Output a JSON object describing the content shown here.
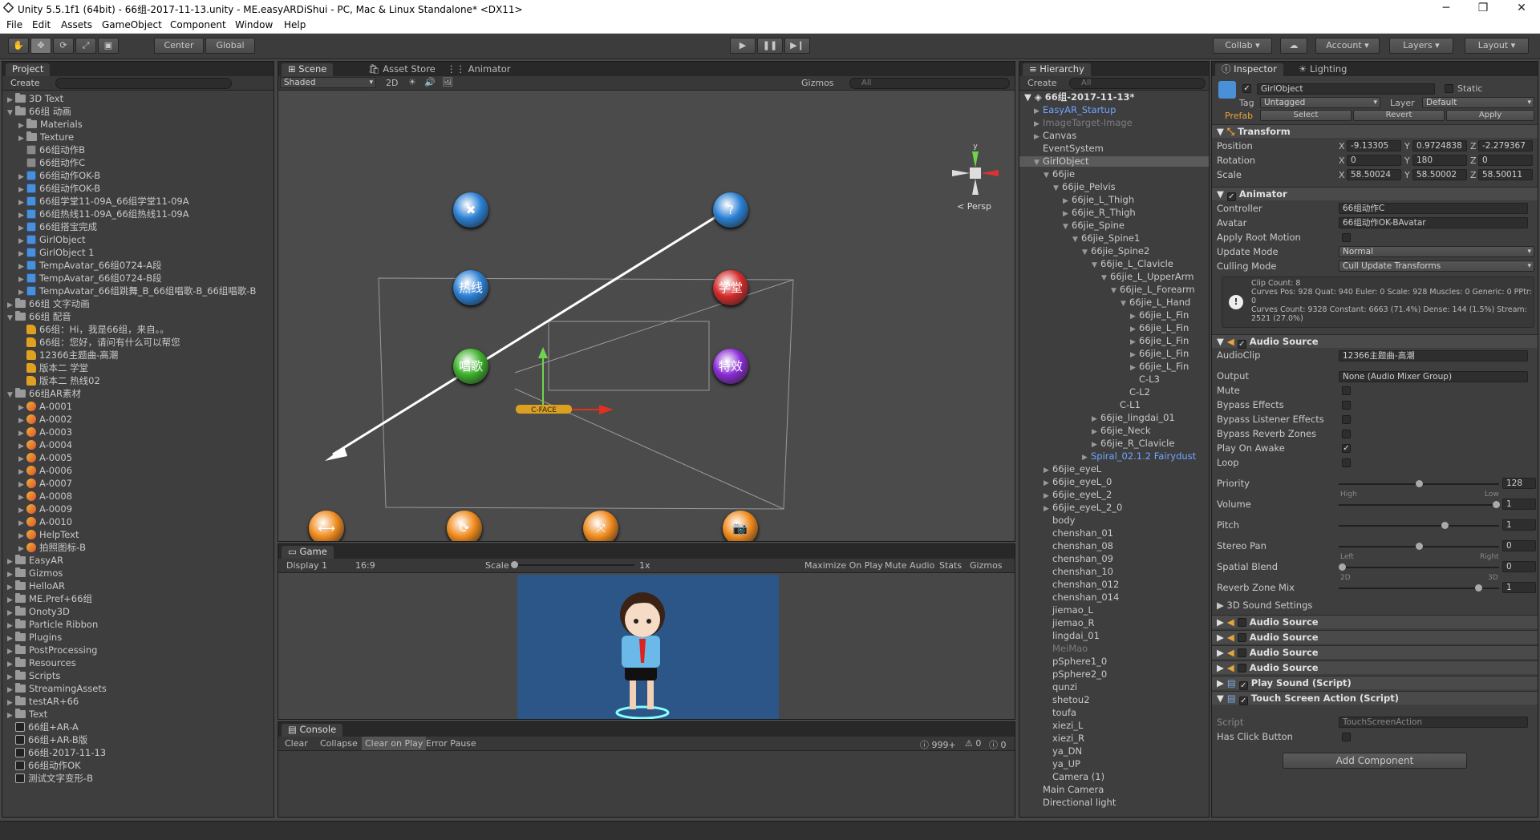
{
  "title": "Unity 5.5.1f1 (64bit) - 66组-2017-11-13.unity - ME.easyARDiShui - PC, Mac & Linux Standalone* <DX11>",
  "menu": [
    "File",
    "Edit",
    "Assets",
    "GameObject",
    "Component",
    "Window",
    "Help"
  ],
  "toolbar": {
    "center": "Center",
    "global": "Global",
    "collab": "Collab",
    "account": "Account",
    "layers": "Layers",
    "layout": "Layout"
  },
  "project": {
    "tab": "Project",
    "create": "Create",
    "items": [
      {
        "t": "3D Text",
        "d": 0,
        "k": "folder",
        "a": "▶"
      },
      {
        "t": "66组 动画",
        "d": 0,
        "k": "folder",
        "a": "▼"
      },
      {
        "t": "Materials",
        "d": 1,
        "k": "folder",
        "a": "▶"
      },
      {
        "t": "Texture",
        "d": 1,
        "k": "folder",
        "a": "▶"
      },
      {
        "t": "66组动作B",
        "d": 1,
        "k": "anim",
        "a": ""
      },
      {
        "t": "66组动作C",
        "d": 1,
        "k": "anim",
        "a": ""
      },
      {
        "t": "66组动作OK-B",
        "d": 1,
        "k": "prefab",
        "a": "▶"
      },
      {
        "t": "66组动作OK-B",
        "d": 1,
        "k": "prefab",
        "a": "▶"
      },
      {
        "t": "66组学堂11-09A_66组学堂11-09A",
        "d": 1,
        "k": "prefab",
        "a": "▶"
      },
      {
        "t": "66组热线11-09A_66组热线11-09A",
        "d": 1,
        "k": "prefab",
        "a": "▶"
      },
      {
        "t": "66组搭宝完成",
        "d": 1,
        "k": "prefab",
        "a": "▶"
      },
      {
        "t": "GirlObject",
        "d": 1,
        "k": "prefab",
        "a": "▶"
      },
      {
        "t": "GirlObject 1",
        "d": 1,
        "k": "prefab",
        "a": "▶"
      },
      {
        "t": "TempAvatar_66组0724-A段",
        "d": 1,
        "k": "prefab",
        "a": "▶"
      },
      {
        "t": "TempAvatar_66组0724-B段",
        "d": 1,
        "k": "prefab",
        "a": "▶"
      },
      {
        "t": "TempAvatar_66组跳舞_B_66组唱歌-B_66组唱歌-B",
        "d": 1,
        "k": "prefab",
        "a": "▶"
      },
      {
        "t": "66组 文字动画",
        "d": 0,
        "k": "folder",
        "a": "▶"
      },
      {
        "t": "66组 配音",
        "d": 0,
        "k": "folder",
        "a": "▼"
      },
      {
        "t": "66组：Hi，我是66组，来自。。",
        "d": 1,
        "k": "audio",
        "a": ""
      },
      {
        "t": "66组：您好，请问有什么可以帮您",
        "d": 1,
        "k": "audio",
        "a": ""
      },
      {
        "t": "12366主题曲-高潮",
        "d": 1,
        "k": "audio",
        "a": ""
      },
      {
        "t": "版本二 学堂",
        "d": 1,
        "k": "audio",
        "a": ""
      },
      {
        "t": "版本二 热线02",
        "d": 1,
        "k": "audio",
        "a": ""
      },
      {
        "t": "66组AR素材",
        "d": 0,
        "k": "folder",
        "a": "▼"
      },
      {
        "t": "A-0001",
        "d": 1,
        "k": "tex",
        "a": "▶"
      },
      {
        "t": "A-0002",
        "d": 1,
        "k": "tex",
        "a": "▶"
      },
      {
        "t": "A-0003",
        "d": 1,
        "k": "tex",
        "a": "▶"
      },
      {
        "t": "A-0004",
        "d": 1,
        "k": "tex",
        "a": "▶"
      },
      {
        "t": "A-0005",
        "d": 1,
        "k": "tex",
        "a": "▶"
      },
      {
        "t": "A-0006",
        "d": 1,
        "k": "tex",
        "a": "▶"
      },
      {
        "t": "A-0007",
        "d": 1,
        "k": "tex",
        "a": "▶"
      },
      {
        "t": "A-0008",
        "d": 1,
        "k": "tex",
        "a": "▶"
      },
      {
        "t": "A-0009",
        "d": 1,
        "k": "tex",
        "a": "▶"
      },
      {
        "t": "A-0010",
        "d": 1,
        "k": "tex",
        "a": "▶"
      },
      {
        "t": "HelpText",
        "d": 1,
        "k": "tex",
        "a": "▶"
      },
      {
        "t": "拍照图标-B",
        "d": 1,
        "k": "tex",
        "a": "▶"
      },
      {
        "t": "EasyAR",
        "d": 0,
        "k": "folder",
        "a": "▶"
      },
      {
        "t": "Gizmos",
        "d": 0,
        "k": "folder",
        "a": "▶"
      },
      {
        "t": "HelloAR",
        "d": 0,
        "k": "folder",
        "a": "▶"
      },
      {
        "t": "ME.Pref+66组",
        "d": 0,
        "k": "folder",
        "a": "▶"
      },
      {
        "t": "Onoty3D",
        "d": 0,
        "k": "folder",
        "a": "▶"
      },
      {
        "t": "Particle Ribbon",
        "d": 0,
        "k": "folder",
        "a": "▶"
      },
      {
        "t": "Plugins",
        "d": 0,
        "k": "folder",
        "a": "▶"
      },
      {
        "t": "PostProcessing",
        "d": 0,
        "k": "folder",
        "a": "▶"
      },
      {
        "t": "Resources",
        "d": 0,
        "k": "folder",
        "a": "▶"
      },
      {
        "t": "Scripts",
        "d": 0,
        "k": "folder",
        "a": "▶"
      },
      {
        "t": "StreamingAssets",
        "d": 0,
        "k": "folder",
        "a": "▶"
      },
      {
        "t": "testAR+66",
        "d": 0,
        "k": "folder",
        "a": "▶"
      },
      {
        "t": "Text",
        "d": 0,
        "k": "folder",
        "a": "▶"
      },
      {
        "t": "66组+AR-A",
        "d": 0,
        "k": "scene",
        "a": ""
      },
      {
        "t": "66组+AR-B版",
        "d": 0,
        "k": "scene",
        "a": ""
      },
      {
        "t": "66组-2017-11-13",
        "d": 0,
        "k": "scene",
        "a": ""
      },
      {
        "t": "66组动作OK",
        "d": 0,
        "k": "scene",
        "a": ""
      },
      {
        "t": "测试文字变形-B",
        "d": 0,
        "k": "scene",
        "a": ""
      }
    ]
  },
  "scene": {
    "tabs": [
      "Scene",
      "Asset Store",
      "Animator"
    ],
    "shaded": "Shaded",
    "mode2d": "2D",
    "gizmos": "Gizmos",
    "search": "All",
    "persp": "Persp",
    "buttons": [
      {
        "label": "✖",
        "color": "#2a7fd4"
      },
      {
        "label": "?",
        "color": "#2a7fd4"
      },
      {
        "label": "热线",
        "color": "#2a7fd4"
      },
      {
        "label": "学堂",
        "color": "#d42a2a"
      },
      {
        "label": "唱歌",
        "color": "#3cb02a"
      },
      {
        "label": "特效",
        "color": "#8a2ad4"
      },
      {
        "label": "⟷",
        "color": "#f08a1c"
      },
      {
        "label": "⟳",
        "color": "#f08a1c"
      },
      {
        "label": "⤧",
        "color": "#f08a1c"
      },
      {
        "label": "📷",
        "color": "#f08a1c"
      }
    ],
    "cface": "C-FACE"
  },
  "game": {
    "tab": "Game",
    "display": "Display 1",
    "aspect": "16:9",
    "scale": "Scale",
    "scale_val": "1x",
    "max": "Maximize On Play",
    "mute": "Mute Audio",
    "stats": "Stats",
    "gizmos": "Gizmos"
  },
  "console": {
    "tab": "Console",
    "clear": "Clear",
    "collapse": "Collapse",
    "clear_on_play": "Clear on Play",
    "error_pause": "Error Pause",
    "count1": "999+",
    "count2": "0",
    "count3": "0"
  },
  "hierarchy": {
    "tab": "Hierarchy",
    "create": "Create",
    "search": "All",
    "scene": "66组-2017-11-13*",
    "items": [
      {
        "t": "EasyAR_Startup",
        "d": 1,
        "s": "blue",
        "a": "▶"
      },
      {
        "t": "ImageTarget-Image",
        "d": 1,
        "s": "gray",
        "a": "▶"
      },
      {
        "t": "Canvas",
        "d": 1,
        "s": "",
        "a": "▶"
      },
      {
        "t": "EventSystem",
        "d": 1,
        "s": "",
        "a": ""
      },
      {
        "t": "GirlObject",
        "d": 1,
        "s": "sel",
        "a": "▼"
      },
      {
        "t": "66jie",
        "d": 2,
        "s": "",
        "a": "▼"
      },
      {
        "t": "66jie_Pelvis",
        "d": 3,
        "s": "",
        "a": "▼"
      },
      {
        "t": "66jie_L_Thigh",
        "d": 4,
        "s": "",
        "a": "▶"
      },
      {
        "t": "66jie_R_Thigh",
        "d": 4,
        "s": "",
        "a": "▶"
      },
      {
        "t": "66jie_Spine",
        "d": 4,
        "s": "",
        "a": "▼"
      },
      {
        "t": "66jie_Spine1",
        "d": 5,
        "s": "",
        "a": "▼"
      },
      {
        "t": "66jie_Spine2",
        "d": 6,
        "s": "",
        "a": "▼"
      },
      {
        "t": "66jie_L_Clavicle",
        "d": 7,
        "s": "",
        "a": "▼"
      },
      {
        "t": "66jie_L_UpperArm",
        "d": 8,
        "s": "",
        "a": "▼"
      },
      {
        "t": "66jie_L_Forearm",
        "d": 9,
        "s": "",
        "a": "▼"
      },
      {
        "t": "66jie_L_Hand",
        "d": 10,
        "s": "",
        "a": "▼"
      },
      {
        "t": "66jie_L_Fin",
        "d": 11,
        "s": "",
        "a": "▶"
      },
      {
        "t": "66jie_L_Fin",
        "d": 11,
        "s": "",
        "a": "▶"
      },
      {
        "t": "66jie_L_Fin",
        "d": 11,
        "s": "",
        "a": "▶"
      },
      {
        "t": "66jie_L_Fin",
        "d": 11,
        "s": "",
        "a": "▶"
      },
      {
        "t": "66jie_L_Fin",
        "d": 11,
        "s": "",
        "a": "▶"
      },
      {
        "t": "C-L3",
        "d": 11,
        "s": "",
        "a": ""
      },
      {
        "t": "C-L2",
        "d": 10,
        "s": "",
        "a": ""
      },
      {
        "t": "C-L1",
        "d": 9,
        "s": "",
        "a": ""
      },
      {
        "t": "66jie_lingdai_01",
        "d": 7,
        "s": "",
        "a": "▶"
      },
      {
        "t": "66jie_Neck",
        "d": 7,
        "s": "",
        "a": "▶"
      },
      {
        "t": "66jie_R_Clavicle",
        "d": 7,
        "s": "",
        "a": "▶"
      },
      {
        "t": "Spiral_02.1.2 Fairydust",
        "d": 6,
        "s": "blue",
        "a": "▶"
      },
      {
        "t": "66jie_eyeL",
        "d": 2,
        "s": "",
        "a": "▶"
      },
      {
        "t": "66jie_eyeL_0",
        "d": 2,
        "s": "",
        "a": "▶"
      },
      {
        "t": "66jie_eyeL_2",
        "d": 2,
        "s": "",
        "a": "▶"
      },
      {
        "t": "66jie_eyeL_2_0",
        "d": 2,
        "s": "",
        "a": "▶"
      },
      {
        "t": "body",
        "d": 2,
        "s": "",
        "a": ""
      },
      {
        "t": "chenshan_01",
        "d": 2,
        "s": "",
        "a": ""
      },
      {
        "t": "chenshan_08",
        "d": 2,
        "s": "",
        "a": ""
      },
      {
        "t": "chenshan_09",
        "d": 2,
        "s": "",
        "a": ""
      },
      {
        "t": "chenshan_10",
        "d": 2,
        "s": "",
        "a": ""
      },
      {
        "t": "chenshan_012",
        "d": 2,
        "s": "",
        "a": ""
      },
      {
        "t": "chenshan_014",
        "d": 2,
        "s": "",
        "a": ""
      },
      {
        "t": "jiemao_L",
        "d": 2,
        "s": "",
        "a": ""
      },
      {
        "t": "jiemao_R",
        "d": 2,
        "s": "",
        "a": ""
      },
      {
        "t": "lingdai_01",
        "d": 2,
        "s": "",
        "a": ""
      },
      {
        "t": "MeiMao",
        "d": 2,
        "s": "gray",
        "a": ""
      },
      {
        "t": "pSphere1_0",
        "d": 2,
        "s": "",
        "a": ""
      },
      {
        "t": "pSphere2_0",
        "d": 2,
        "s": "",
        "a": ""
      },
      {
        "t": "qunzi",
        "d": 2,
        "s": "",
        "a": ""
      },
      {
        "t": "shetou2",
        "d": 2,
        "s": "",
        "a": ""
      },
      {
        "t": "toufa",
        "d": 2,
        "s": "",
        "a": ""
      },
      {
        "t": "xiezi_L",
        "d": 2,
        "s": "",
        "a": ""
      },
      {
        "t": "xiezi_R",
        "d": 2,
        "s": "",
        "a": ""
      },
      {
        "t": "ya_DN",
        "d": 2,
        "s": "",
        "a": ""
      },
      {
        "t": "ya_UP",
        "d": 2,
        "s": "",
        "a": ""
      },
      {
        "t": "Camera (1)",
        "d": 2,
        "s": "",
        "a": ""
      },
      {
        "t": "Main Camera",
        "d": 1,
        "s": "",
        "a": ""
      },
      {
        "t": "Directional light",
        "d": 1,
        "s": "",
        "a": ""
      }
    ]
  },
  "inspector": {
    "tabs": [
      "Inspector",
      "Lighting"
    ],
    "name": "GirlObject",
    "static": "Static",
    "tag_l": "Tag",
    "tag": "Untagged",
    "layer_l": "Layer",
    "layer": "Default",
    "prefab": "Prefab",
    "select": "Select",
    "revert": "Revert",
    "apply": "Apply",
    "transform": {
      "title": "Transform",
      "position": "Position",
      "rotation": "Rotation",
      "scale": "Scale",
      "pos": [
        "-9.13305",
        "0.9724838",
        "-2.279367"
      ],
      "rot": [
        "0",
        "180",
        "0"
      ],
      "scl": [
        "58.50024",
        "58.50002",
        "58.50011"
      ]
    },
    "animator": {
      "title": "Animator",
      "controller_l": "Controller",
      "controller": "66组动作C",
      "avatar_l": "Avatar",
      "avatar": "66组动作OK-BAvatar",
      "root_l": "Apply Root Motion",
      "update_l": "Update Mode",
      "update": "Normal",
      "culling_l": "Culling Mode",
      "culling": "Cull Update Transforms",
      "info": [
        "Clip Count: 8",
        "Curves Pos: 928 Quat: 940 Euler: 0 Scale: 928 Muscles: 0 Generic: 0 PPtr: 0",
        "Curves Count: 9328 Constant: 6663 (71.4%) Dense: 144 (1.5%) Stream: 2521 (27.0%)"
      ]
    },
    "audio": {
      "title": "Audio Source",
      "clip_l": "AudioClip",
      "clip": "12366主题曲-高潮",
      "output_l": "Output",
      "output": "None (Audio Mixer Group)",
      "mute": "Mute",
      "bypass_fx": "Bypass Effects",
      "bypass_listener": "Bypass Listener Effects",
      "bypass_reverb": "Bypass Reverb Zones",
      "play_awake": "Play On Awake",
      "loop": "Loop",
      "priority_l": "Priority",
      "priority": "128",
      "high": "High",
      "low": "Low",
      "volume_l": "Volume",
      "volume": "1",
      "pitch_l": "Pitch",
      "pitch": "1",
      "pan_l": "Stereo Pan",
      "pan": "0",
      "left": "Left",
      "right": "Right",
      "blend_l": "Spatial Blend",
      "blend": "0",
      "d2": "2D",
      "d3": "3D",
      "reverb_l": "Reverb Zone Mix",
      "reverb": "1",
      "sound3d": "3D Sound Settings"
    },
    "collapsed": [
      "Audio Source",
      "Audio Source",
      "Audio Source",
      "Audio Source",
      "Play Sound (Script)",
      "Touch Screen Action (Script)"
    ],
    "touch": {
      "script_l": "Script",
      "script": "TouchScreenAction",
      "click_l": "Has Click Button"
    },
    "add": "Add Component"
  }
}
